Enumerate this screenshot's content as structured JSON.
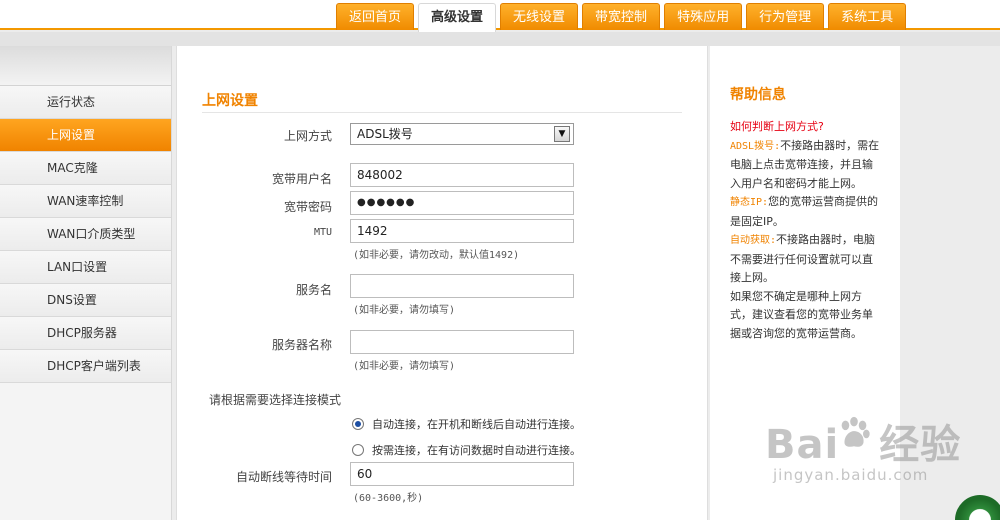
{
  "nav": {
    "tabs": [
      {
        "label": "返回首页"
      },
      {
        "label": "高级设置"
      },
      {
        "label": "无线设置"
      },
      {
        "label": "带宽控制"
      },
      {
        "label": "特殊应用"
      },
      {
        "label": "行为管理"
      },
      {
        "label": "系统工具"
      }
    ],
    "active_tab": "高级设置"
  },
  "sidebar": {
    "items": [
      {
        "label": "运行状态"
      },
      {
        "label": "上网设置"
      },
      {
        "label": "MAC克隆"
      },
      {
        "label": "WAN速率控制"
      },
      {
        "label": "WAN口介质类型"
      },
      {
        "label": "LAN口设置"
      },
      {
        "label": "DNS设置"
      },
      {
        "label": "DHCP服务器"
      },
      {
        "label": "DHCP客户端列表"
      }
    ],
    "active_item": "上网设置"
  },
  "form": {
    "title": "上网设置",
    "connection_type": {
      "label": "上网方式",
      "value": "ADSL拨号"
    },
    "username": {
      "label": "宽带用户名",
      "value": "848002"
    },
    "password": {
      "label": "宽带密码",
      "value": "●●●●●●"
    },
    "mtu": {
      "label": "MTU",
      "value": "1492",
      "hint": "(如非必要，请勿改动，默认值1492)"
    },
    "service_name": {
      "label": "服务名",
      "value": "",
      "hint": "(如非必要，请勿填写)"
    },
    "server_name": {
      "label": "服务器名称",
      "value": "",
      "hint": "(如非必要，请勿填写)"
    },
    "mode_label": "请根据需要选择连接模式",
    "mode_auto": "自动连接，在开机和断线后自动进行连接。",
    "mode_demand": "按需连接，在有访问数据时自动进行连接。",
    "selected_mode": "auto",
    "idle_time": {
      "label": "自动断线等待时间",
      "value": "60",
      "hint": "(60-3600,秒)"
    }
  },
  "help": {
    "title": "帮助信息",
    "question": "如何判断上网方式?",
    "adsl_key": "ADSL拨号:",
    "adsl_text": "不接路由器时，需在电脑上点击宽带连接，并且输入用户名和密码才能上网。",
    "static_key": "静态IP:",
    "static_text": "您的宽带运营商提供的是固定IP。",
    "dhcp_key": "自动获取:",
    "dhcp_text": "不接路由器时，电脑不需要进行任何设置就可以直接上网。",
    "unsure_text": "如果您不确定是哪种上网方式，建议查看您的宽带业务单据或咨询您的宽带运营商。"
  },
  "watermark": {
    "brand": "Bai",
    "brand_suffix": "经验",
    "url": "jingyan.baidu.com"
  },
  "colors": {
    "accent": "#f08300",
    "question": "#e60012",
    "radio": "#1d4fa3"
  }
}
